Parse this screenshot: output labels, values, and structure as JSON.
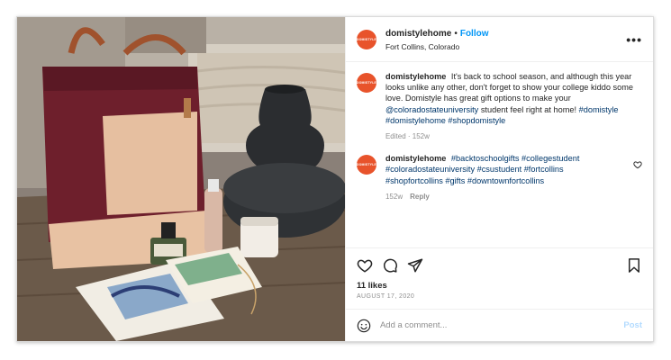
{
  "post": {
    "username": "domistylehome",
    "separator": "•",
    "follow_label": "Follow",
    "location": "Fort Collins, Colorado",
    "avatar_text": "DOMISTYLE",
    "brand_color": "#e8532b",
    "more_icon": "more-horizontal-icon"
  },
  "caption": {
    "username": "domistylehome",
    "text": "It's back to school season, and although this year looks unlike any other, don't forget to show your college kiddo some love. Domistyle has great gift options to make your",
    "mention": "@coloradostateuniversity",
    "text_after": "student feel right at home!",
    "hashtags": "#domistyle #domistylehome #shopdomistyle",
    "meta": "Edited · 152w"
  },
  "comment": {
    "username": "domistylehome",
    "hashtags": "#backtoschoolgifts #collegestudent #coloradostateuniversity #csustudent #fortcollins #shopfortcollins #gifts #downtownfortcollins",
    "time": "152w",
    "reply_label": "Reply",
    "like_icon": "heart-icon"
  },
  "actions": {
    "icons": [
      "heart-icon",
      "comment-icon",
      "share-icon",
      "bookmark-icon"
    ],
    "likes": "11 likes",
    "date": "AUGUST 17, 2020"
  },
  "composer": {
    "placeholder": "Add a comment...",
    "post_label": "Post",
    "emoji_icon": "emoji-icon"
  }
}
